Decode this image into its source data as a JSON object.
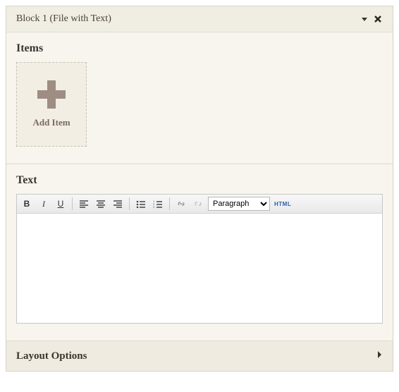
{
  "block": {
    "title": "Block 1 (File with Text)"
  },
  "items": {
    "heading": "Items",
    "add_label": "Add Item"
  },
  "text": {
    "heading": "Text",
    "format_select": "Paragraph",
    "html_label": "HTML",
    "content": ""
  },
  "layout": {
    "heading": "Layout Options"
  },
  "toolbar": {
    "bold": "B",
    "italic": "I",
    "underline": "U"
  }
}
